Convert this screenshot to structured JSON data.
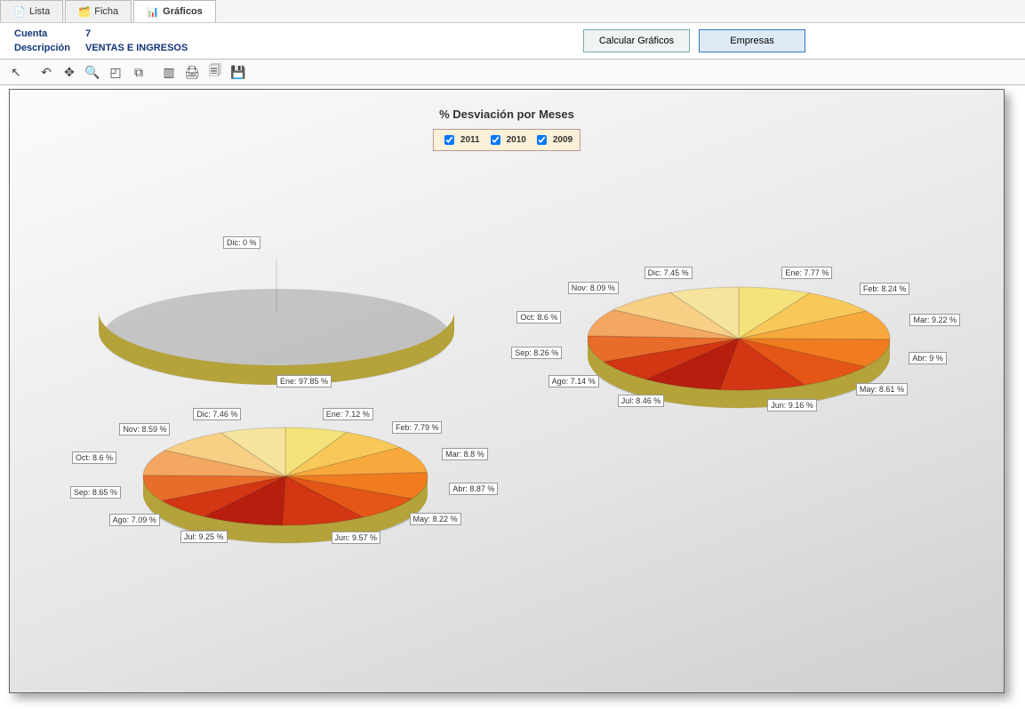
{
  "tabs": {
    "lista": "Lista",
    "ficha": "Ficha",
    "graficos": "Gráficos"
  },
  "header": {
    "cuenta_label": "Cuenta",
    "cuenta_value": "7",
    "descripcion_label": "Descripción",
    "descripcion_value": "VENTAS E INGRESOS"
  },
  "buttons": {
    "calcular": "Calcular Gráficos",
    "empresas": "Empresas"
  },
  "chart": {
    "title": "% Desviación por Meses",
    "legend": {
      "y1": "2011",
      "y2": "2010",
      "y3": "2009"
    }
  },
  "colors": {
    "months": [
      "#f4e27a",
      "#f8c95a",
      "#f7a93d",
      "#f07c1f",
      "#e45618",
      "#d23612",
      "#b71e0e",
      "#d23612",
      "#e86c2a",
      "#f3a760",
      "#f7cf85",
      "#f6e39e"
    ]
  },
  "chart_data": [
    {
      "type": "pie",
      "title": "2011",
      "series": [
        {
          "name": "2011",
          "values": [
            97.85,
            0,
            0,
            0,
            0,
            0,
            0,
            0,
            0,
            0,
            0,
            0.0
          ]
        }
      ],
      "categories": [
        "Ene",
        "Feb",
        "Mar",
        "Abr",
        "May",
        "Jun",
        "Jul",
        "Ago",
        "Sep",
        "Oct",
        "Nov",
        "Dic"
      ],
      "labels": [
        "Ene: 97.85 %",
        "Dic: 0 %"
      ]
    },
    {
      "type": "pie",
      "title": "2010",
      "series": [
        {
          "name": "2010",
          "values": [
            7.12,
            7.79,
            8.8,
            8.87,
            8.22,
            9.57,
            9.25,
            7.09,
            8.65,
            8.6,
            8.59,
            7.46
          ]
        }
      ],
      "categories": [
        "Ene",
        "Feb",
        "Mar",
        "Abr",
        "May",
        "Jun",
        "Jul",
        "Ago",
        "Sep",
        "Oct",
        "Nov",
        "Dic"
      ],
      "labels": [
        "Ene: 7.12 %",
        "Feb: 7.79 %",
        "Mar: 8.8 %",
        "Abr: 8.87 %",
        "May: 8.22 %",
        "Jun: 9.57 %",
        "Jul: 9.25 %",
        "Ago: 7.09 %",
        "Sep: 8.65 %",
        "Oct: 8.6 %",
        "Nov: 8.59 %",
        "Dic: 7.46 %"
      ]
    },
    {
      "type": "pie",
      "title": "2009",
      "series": [
        {
          "name": "2009",
          "values": [
            7.77,
            8.24,
            9.22,
            9.0,
            8.61,
            9.16,
            8.46,
            7.14,
            8.26,
            8.6,
            8.09,
            7.45
          ]
        }
      ],
      "categories": [
        "Ene",
        "Feb",
        "Mar",
        "Abr",
        "May",
        "Jun",
        "Jul",
        "Ago",
        "Sep",
        "Oct",
        "Nov",
        "Dic"
      ],
      "labels": [
        "Ene: 7.77 %",
        "Feb: 8.24 %",
        "Mar: 9.22 %",
        "Abr: 9 %",
        "May: 8.61 %",
        "Jun: 9.16 %",
        "Jul: 8.46 %",
        "Ago: 7.14 %",
        "Sep: 8.26 %",
        "Oct: 8.6 %",
        "Nov: 8.09 %",
        "Dic: 7.45 %"
      ]
    }
  ]
}
